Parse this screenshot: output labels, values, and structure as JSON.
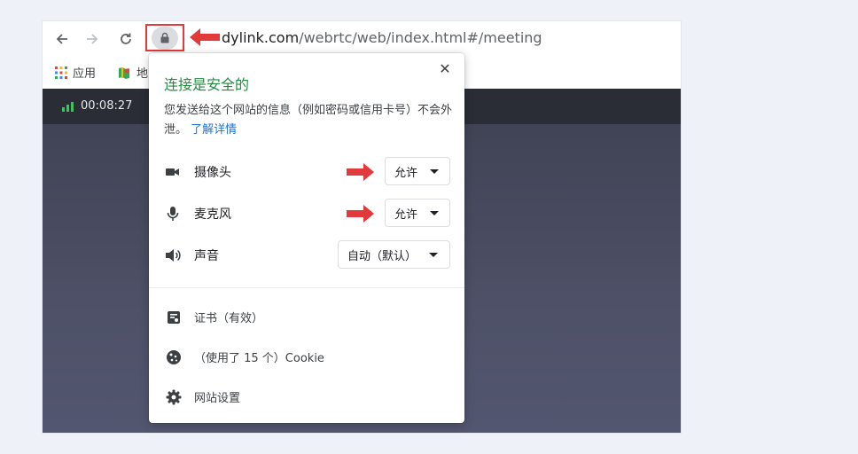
{
  "browser": {
    "url_host_visible": "dylink.com",
    "url_path": "/webrtc/web/index.html#/meeting",
    "bookmarks": [
      {
        "label": "应用",
        "icon": "apps-grid-icon"
      },
      {
        "label": "地",
        "icon": "maps-icon"
      }
    ]
  },
  "meeting": {
    "timer": "00:08:27"
  },
  "popup": {
    "title": "连接是安全的",
    "description": "您发送给这个网站的信息（例如密码或信用卡号）不会外泄。",
    "learn_more": "了解详情",
    "close_label": "✕",
    "permissions": [
      {
        "label": "摄像头",
        "icon": "camera-icon",
        "value": "允许"
      },
      {
        "label": "麦克风",
        "icon": "microphone-icon",
        "value": "允许"
      },
      {
        "label": "声音",
        "icon": "speaker-icon",
        "value": "自动（默认）"
      }
    ],
    "items": [
      {
        "label": "证书（有效）",
        "icon": "certificate-icon"
      },
      {
        "label": "（使用了 15 个）Cookie",
        "icon": "cookie-icon"
      },
      {
        "label": "网站设置",
        "icon": "gear-icon"
      }
    ]
  },
  "colors": {
    "secure_green": "#1e8e3e",
    "link_blue": "#1a73e8",
    "annotation_red": "#e23a3a"
  }
}
